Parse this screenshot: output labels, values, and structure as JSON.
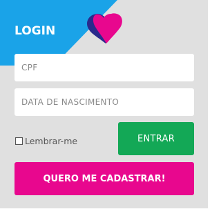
{
  "login": {
    "title": "LOGIN",
    "logo_icon": "heart-logo-icon",
    "fields": {
      "cpf": {
        "placeholder": "CPF",
        "value": ""
      },
      "birth_date": {
        "placeholder": "DATA DE NASCIMENTO",
        "value": ""
      }
    },
    "remember": {
      "label": "Lembrar-me",
      "checked": false
    },
    "enter_label": "ENTRAR",
    "register_label": "QUERO ME CADASTRAR!"
  },
  "colors": {
    "panel_bg": "#e0e0e0",
    "banner_blue": "#1aa3e8",
    "heart_dark": "#2a2a8c",
    "heart_pink": "#e8078e",
    "enter_green": "#13a856",
    "register_pink": "#e8078e"
  }
}
